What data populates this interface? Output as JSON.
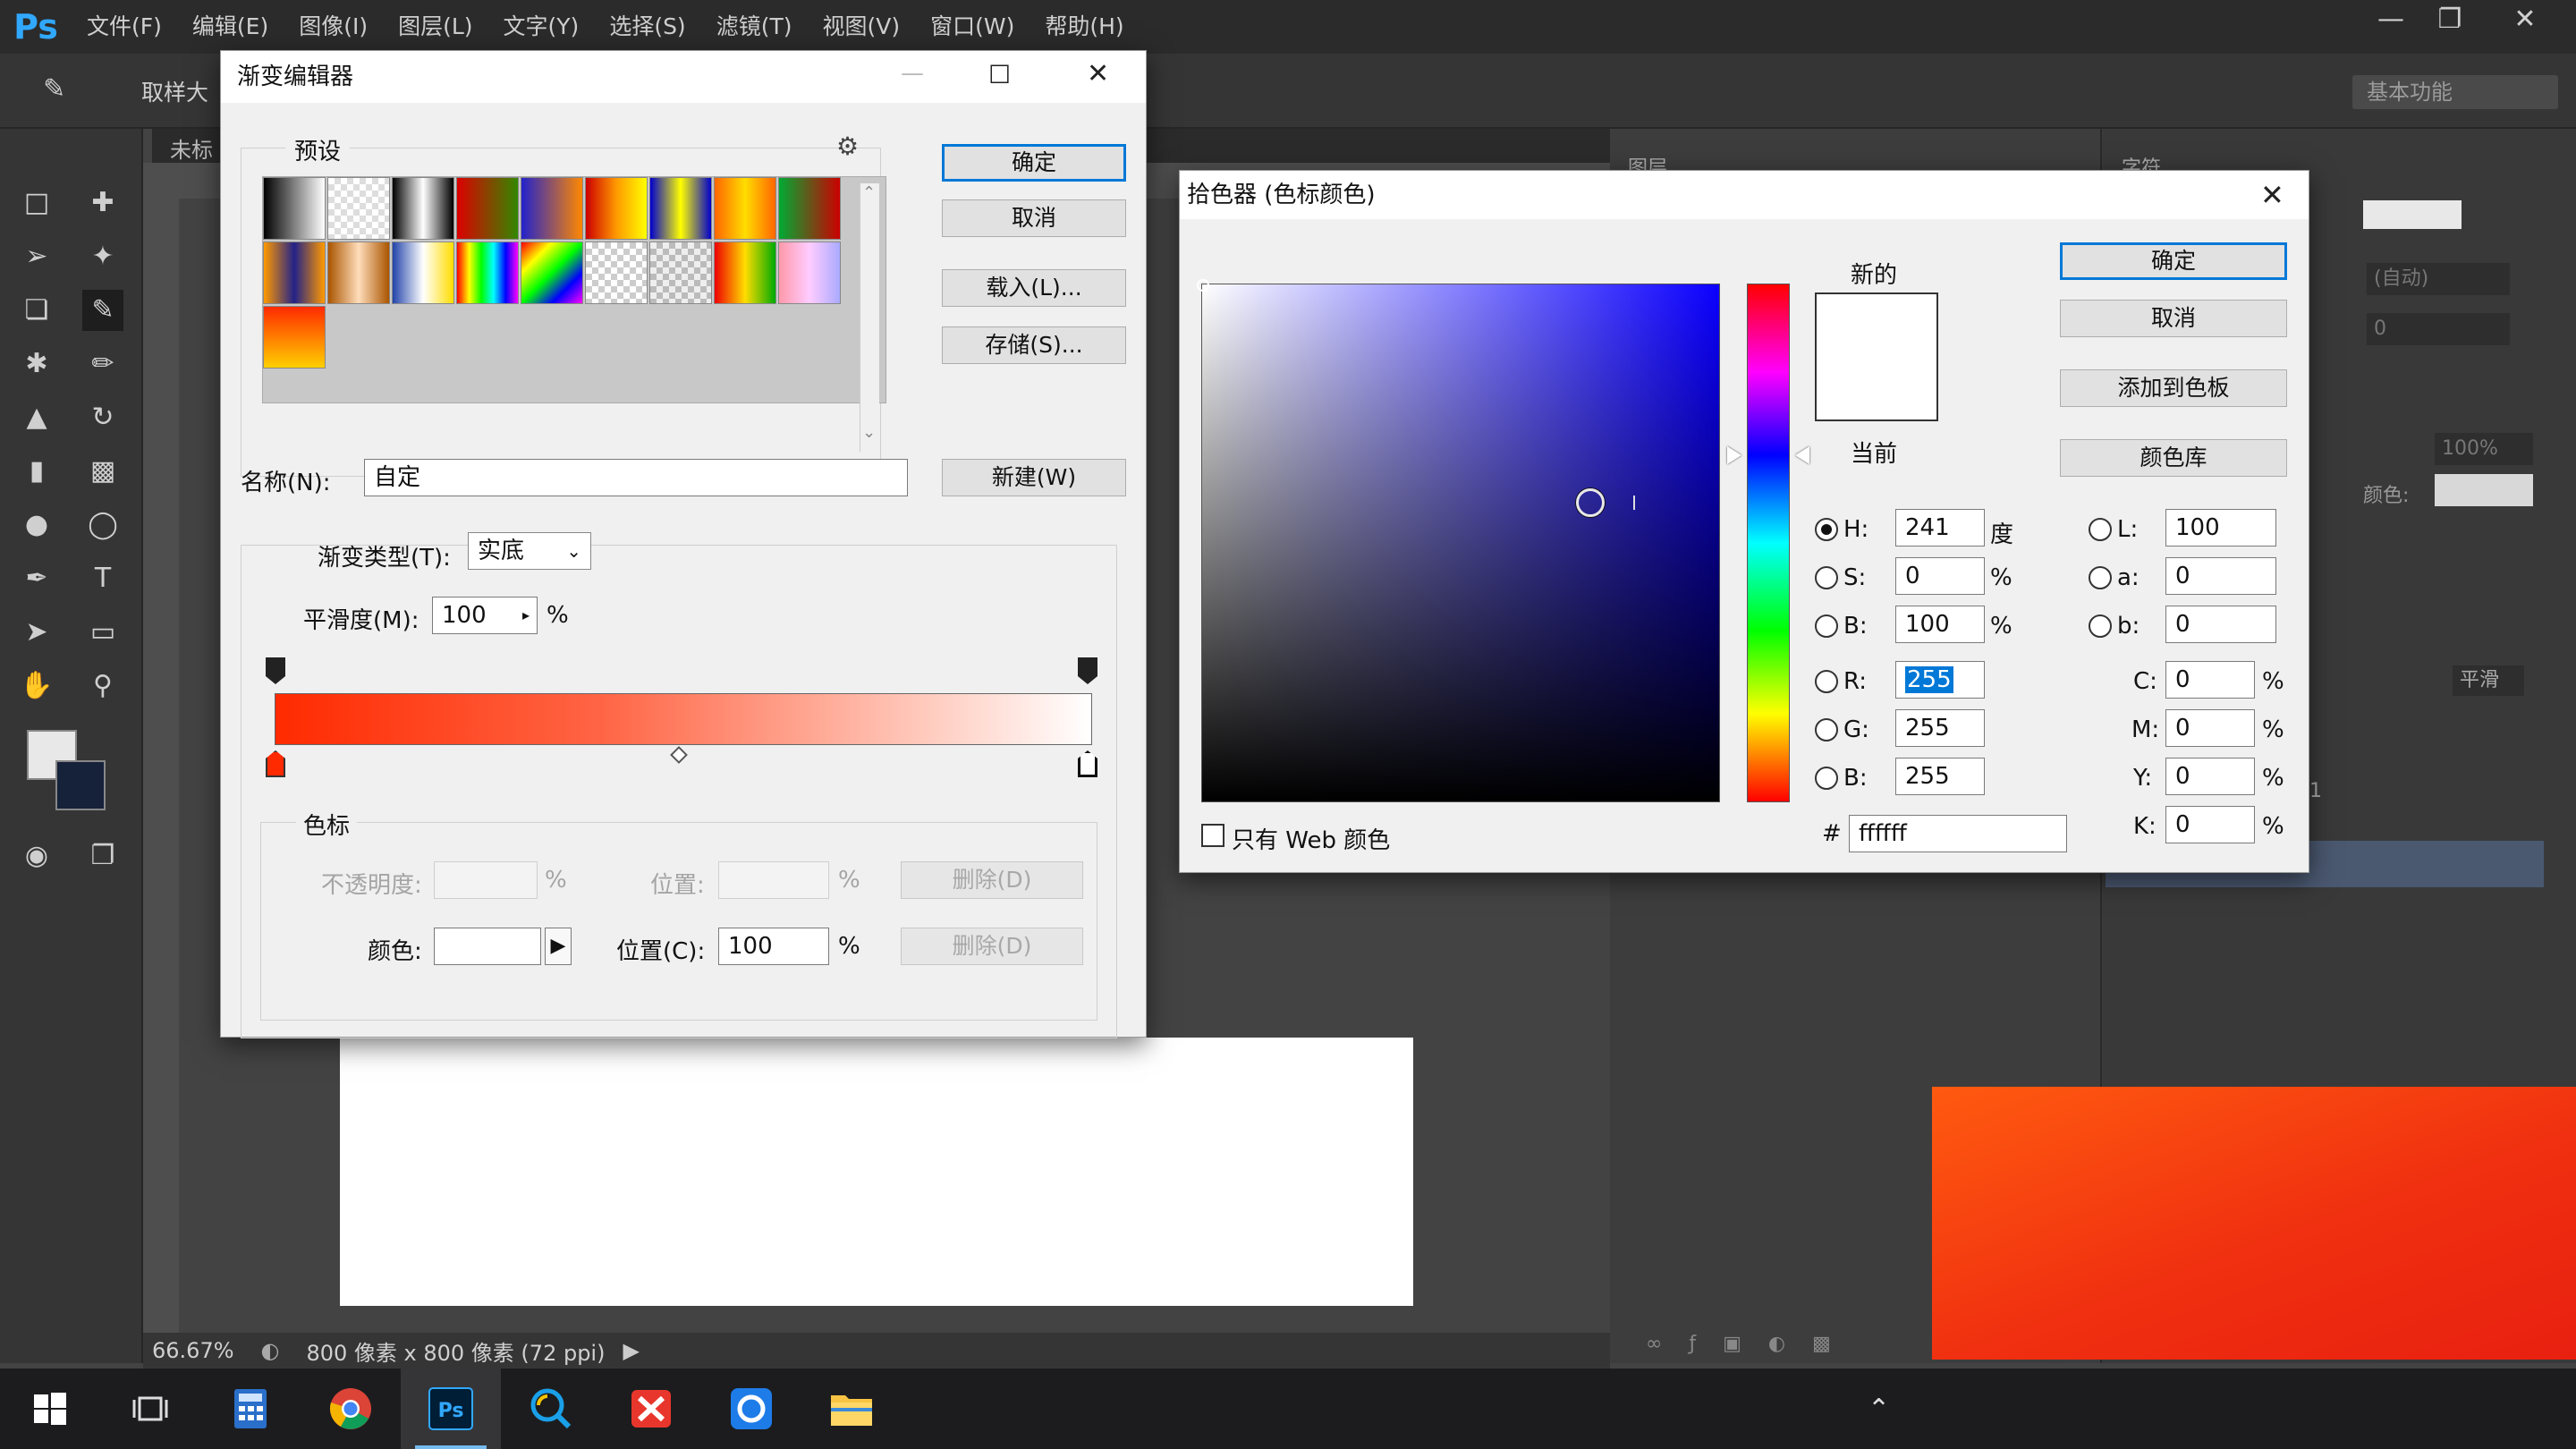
{
  "app": {
    "logo": "Ps",
    "menus": [
      "文件(F)",
      "编辑(E)",
      "图像(I)",
      "图层(L)",
      "文字(Y)",
      "选择(S)",
      "滤镜(T)",
      "视图(V)",
      "窗口(W)",
      "帮助(H)"
    ],
    "options_label": "取样大",
    "doc_tab": "未标",
    "essentials": "基本功能",
    "right_panel_font_auto": "(自动)",
    "right_panel_tracking": "0",
    "right_panel_scale": "100%",
    "right_panel_color_label": "颜色:",
    "right_panel_aa": "平滑",
    "right_panel_sample": "1",
    "panel_tab_layers": "图层",
    "panel_tab_char": "字符"
  },
  "status": {
    "zoom": "66.67%",
    "doc_size": "800 像素 x 800 像素 (72 ppi)"
  },
  "gradient_editor": {
    "title": "渐变编辑器",
    "presets_label": "预设",
    "buttons": {
      "ok": "确定",
      "cancel": "取消",
      "load": "载入(L)...",
      "save": "存储(S)...",
      "new": "新建(W)"
    },
    "name_label": "名称(N):",
    "name_value": "自定",
    "type_label": "渐变类型(T):",
    "type_value": "实底",
    "smoothness_label": "平滑度(M):",
    "smoothness_value": "100",
    "percent": "%",
    "stops_group": "色标",
    "opacity_label": "不透明度:",
    "location_label": "位置:",
    "delete_label": "删除(D)",
    "color_label": "颜色:",
    "color_location_label": "位置(C):",
    "color_location_value": "100",
    "gradient_colors": [
      "#ff2a00",
      "#ff6545",
      "#ffc6b8",
      "#ffffff"
    ]
  },
  "color_picker": {
    "title": "拾色器 (色标颜色)",
    "new_label": "新的",
    "current_label": "当前",
    "buttons": {
      "ok": "确定",
      "cancel": "取消",
      "add_swatch": "添加到色板",
      "libraries": "颜色库"
    },
    "web_only_label": "只有 Web 颜色",
    "hsb": {
      "H": "241",
      "S": "0",
      "B": "100"
    },
    "degree": "度",
    "rgb": {
      "R": "255",
      "G": "255",
      "B": "255"
    },
    "lab": {
      "L": "100",
      "a": "0",
      "b": "0"
    },
    "cmyk": {
      "C": "0",
      "M": "0",
      "Y": "0",
      "K": "0"
    },
    "hex_symbol": "#",
    "hex": "ffffff",
    "labels": {
      "H": "H:",
      "S": "S:",
      "B": "B:",
      "R": "R:",
      "G": "G:",
      "B2": "B:",
      "L": "L:",
      "a": "a:",
      "b": "b:",
      "C": "C:",
      "M": "M:",
      "Y": "Y:",
      "K": "K:"
    },
    "percent": "%",
    "new_color": "#ffffff",
    "hue_color": "#0b00ff"
  },
  "taskbar": {
    "icons": [
      "windows-start",
      "task-view",
      "calculator",
      "chrome",
      "photoshop",
      "search-app",
      "wps",
      "qq-browser",
      "file-explorer"
    ],
    "active": "photoshop"
  }
}
